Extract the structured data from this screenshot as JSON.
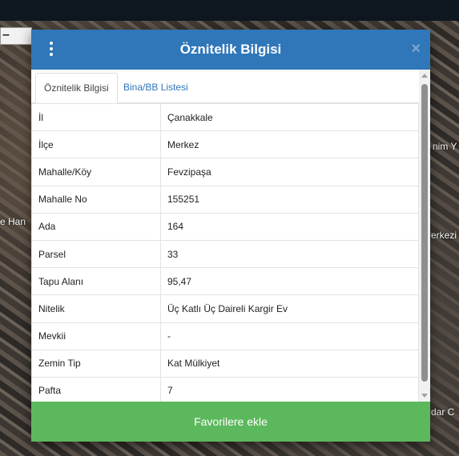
{
  "map": {
    "labels": [
      "nim Y",
      "e Han",
      "erkezi",
      "dar C"
    ]
  },
  "dialog": {
    "title": "Öznitelik Bilgisi",
    "close": "×",
    "tabs": [
      {
        "label": "Öznitelik Bilgisi",
        "active": true
      },
      {
        "label": "Bina/BB Listesi",
        "active": false
      }
    ],
    "rows": [
      {
        "key": "İl",
        "value": "Çanakkale"
      },
      {
        "key": "İlçe",
        "value": "Merkez"
      },
      {
        "key": "Mahalle/Köy",
        "value": "Fevzipaşa"
      },
      {
        "key": "Mahalle No",
        "value": "155251"
      },
      {
        "key": "Ada",
        "value": "164"
      },
      {
        "key": "Parsel",
        "value": "33"
      },
      {
        "key": "Tapu Alanı",
        "value": "95,47"
      },
      {
        "key": "Nitelik",
        "value": "Üç Katlı Üç Daireli Kargir Ev"
      },
      {
        "key": "Mevkii",
        "value": "-"
      },
      {
        "key": "Zemin Tip",
        "value": "Kat Mülkiyet"
      },
      {
        "key": "Pafta",
        "value": "7"
      }
    ],
    "favorite_button": "Favorilere ekle"
  },
  "colors": {
    "header": "#2f77b9",
    "button": "#5cb85c",
    "tab_link": "#2f77b9"
  },
  "icons": {
    "menu": "menu-dots-icon",
    "close": "close-icon"
  }
}
